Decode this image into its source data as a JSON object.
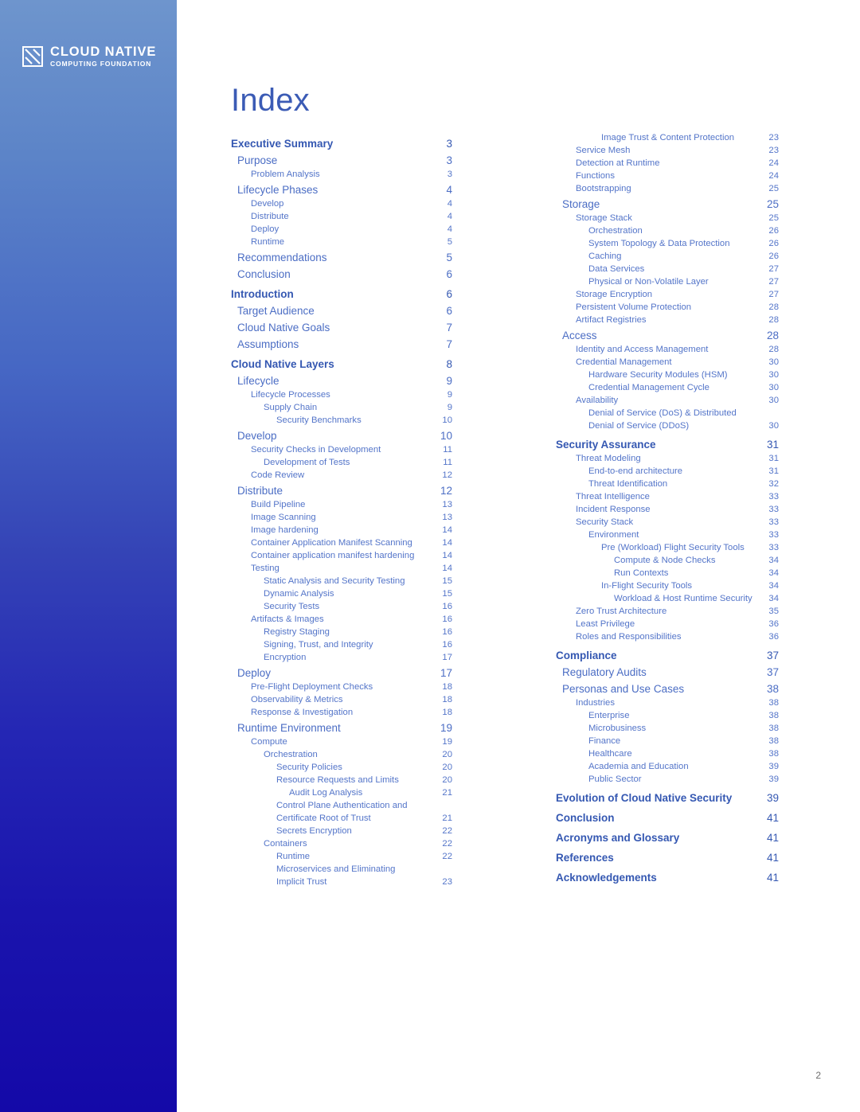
{
  "brand": {
    "logo_line1": "CLOUD NATIVE",
    "logo_line2": "COMPUTING FOUNDATION",
    "logo_icon": "cncf-mark-icon",
    "sidebar_gradient_top": "#6e95cd",
    "sidebar_gradient_mid": "#3443b6",
    "sidebar_gradient_bottom": "#1409a8"
  },
  "page": {
    "title": "Index",
    "page_number": "2",
    "title_color": "#3b5bb5",
    "level0_color": "#3558b2",
    "level1_color": "#4b6dc4",
    "sub_color": "#5475c9"
  },
  "toc": {
    "left_column": [
      {
        "label": "Executive Summary",
        "page": "3",
        "level": 0
      },
      {
        "label": "Purpose",
        "page": "3",
        "level": 1
      },
      {
        "label": "Problem Analysis",
        "page": "3",
        "level": 2
      },
      {
        "label": "Lifecycle Phases",
        "page": "4",
        "level": 1
      },
      {
        "label": "Develop",
        "page": "4",
        "level": 2
      },
      {
        "label": "Distribute",
        "page": "4",
        "level": 2
      },
      {
        "label": "Deploy",
        "page": "4",
        "level": 2
      },
      {
        "label": "Runtime",
        "page": "5",
        "level": 2
      },
      {
        "label": "Recommendations",
        "page": "5",
        "level": 1
      },
      {
        "label": "Conclusion",
        "page": "6",
        "level": 1
      },
      {
        "label": "Introduction",
        "page": "6",
        "level": 0
      },
      {
        "label": "Target Audience",
        "page": "6",
        "level": 1
      },
      {
        "label": "Cloud Native Goals",
        "page": "7",
        "level": 1
      },
      {
        "label": "Assumptions",
        "page": "7",
        "level": 1
      },
      {
        "label": "Cloud Native Layers",
        "page": "8",
        "level": 0
      },
      {
        "label": "Lifecycle",
        "page": "9",
        "level": 1
      },
      {
        "label": "Lifecycle Processes",
        "page": "9",
        "level": 2
      },
      {
        "label": "Supply Chain",
        "page": "9",
        "level": 3
      },
      {
        "label": "Security Benchmarks",
        "page": "10",
        "level": 4
      },
      {
        "label": "Develop",
        "page": "10",
        "level": 1
      },
      {
        "label": "Security Checks in Development",
        "page": "11",
        "level": 2
      },
      {
        "label": "Development of Tests",
        "page": "11",
        "level": 3
      },
      {
        "label": "Code Review",
        "page": "12",
        "level": 2
      },
      {
        "label": "Distribute",
        "page": "12",
        "level": 1
      },
      {
        "label": "Build Pipeline",
        "page": "13",
        "level": 2
      },
      {
        "label": "Image Scanning",
        "page": "13",
        "level": 2
      },
      {
        "label": "Image hardening",
        "page": "14",
        "level": 2
      },
      {
        "label": "Container Application Manifest Scanning",
        "page": "14",
        "level": 2
      },
      {
        "label": "Container application manifest hardening",
        "page": "14",
        "level": 2
      },
      {
        "label": "Testing",
        "page": "14",
        "level": 2
      },
      {
        "label": "Static Analysis and Security Testing",
        "page": "15",
        "level": 3
      },
      {
        "label": "Dynamic Analysis",
        "page": "15",
        "level": 3
      },
      {
        "label": "Security Tests",
        "page": "16",
        "level": 3
      },
      {
        "label": "Artifacts & Images",
        "page": "16",
        "level": 2
      },
      {
        "label": "Registry Staging",
        "page": "16",
        "level": 3
      },
      {
        "label": "Signing, Trust, and Integrity",
        "page": "16",
        "level": 3
      },
      {
        "label": "Encryption",
        "page": "17",
        "level": 3
      },
      {
        "label": "Deploy",
        "page": "17",
        "level": 1
      },
      {
        "label": "Pre-Flight Deployment Checks",
        "page": "18",
        "level": 2
      },
      {
        "label": "Observability & Metrics",
        "page": "18",
        "level": 2
      },
      {
        "label": "Response & Investigation",
        "page": "18",
        "level": 2
      },
      {
        "label": "Runtime Environment",
        "page": "19",
        "level": 1
      },
      {
        "label": "Compute",
        "page": "19",
        "level": 2
      },
      {
        "label": "Orchestration",
        "page": "20",
        "level": 3
      },
      {
        "label": "Security Policies",
        "page": "20",
        "level": 4
      },
      {
        "label": "Resource Requests and Limits",
        "page": "20",
        "level": 4
      },
      {
        "label": "Audit Log Analysis",
        "page": "21",
        "level": 5
      },
      {
        "label": "Control Plane Authentication and",
        "page": "",
        "level": 4,
        "continuation": true
      },
      {
        "label": "Certificate Root of Trust",
        "page": "21",
        "level": 4
      },
      {
        "label": "Secrets Encryption",
        "page": "22",
        "level": 4
      },
      {
        "label": "Containers",
        "page": "22",
        "level": 3
      },
      {
        "label": "Runtime",
        "page": "22",
        "level": 4
      },
      {
        "label": "Microservices and Eliminating",
        "page": "",
        "level": 4,
        "continuation": true
      },
      {
        "label": "Implicit Trust",
        "page": "23",
        "level": 4
      }
    ],
    "right_column": [
      {
        "label": "Image Trust & Content Protection",
        "page": "23",
        "level": 4
      },
      {
        "label": "Service Mesh",
        "page": "23",
        "level": 2
      },
      {
        "label": "Detection at Runtime",
        "page": "24",
        "level": 2
      },
      {
        "label": "Functions",
        "page": "24",
        "level": 2
      },
      {
        "label": "Bootstrapping",
        "page": "25",
        "level": 2
      },
      {
        "label": "Storage",
        "page": "25",
        "level": 1
      },
      {
        "label": "Storage Stack",
        "page": "25",
        "level": 2
      },
      {
        "label": "Orchestration",
        "page": "26",
        "level": 3
      },
      {
        "label": "System Topology & Data Protection",
        "page": "26",
        "level": 3
      },
      {
        "label": "Caching",
        "page": "26",
        "level": 3
      },
      {
        "label": "Data Services",
        "page": "27",
        "level": 3
      },
      {
        "label": "Physical  or Non-Volatile Layer",
        "page": "27",
        "level": 3
      },
      {
        "label": "Storage Encryption",
        "page": "27",
        "level": 2
      },
      {
        "label": "Persistent Volume Protection",
        "page": "28",
        "level": 2
      },
      {
        "label": "Artifact Registries",
        "page": "28",
        "level": 2
      },
      {
        "label": "Access",
        "page": "28",
        "level": 1
      },
      {
        "label": "Identity and Access Management",
        "page": "28",
        "level": 2
      },
      {
        "label": "Credential Management",
        "page": "30",
        "level": 2
      },
      {
        "label": "Hardware Security Modules (HSM)",
        "page": "30",
        "level": 3
      },
      {
        "label": "Credential Management Cycle",
        "page": "30",
        "level": 3
      },
      {
        "label": "Availability",
        "page": "30",
        "level": 2
      },
      {
        "label": "Denial of Service (DoS) & Distributed",
        "page": "",
        "level": 3,
        "continuation": true
      },
      {
        "label": "Denial of Service (DDoS)",
        "page": "30",
        "level": 3
      },
      {
        "label": "Security Assurance",
        "page": "31",
        "level": 0
      },
      {
        "label": "Threat Modeling",
        "page": "31",
        "level": 2
      },
      {
        "label": "End-to-end architecture",
        "page": "31",
        "level": 3
      },
      {
        "label": "Threat Identification",
        "page": "32",
        "level": 3
      },
      {
        "label": "Threat Intelligence",
        "page": "33",
        "level": 2
      },
      {
        "label": "Incident Response",
        "page": "33",
        "level": 2
      },
      {
        "label": "Security Stack",
        "page": "33",
        "level": 2
      },
      {
        "label": "Environment",
        "page": "33",
        "level": 3
      },
      {
        "label": "Pre (Workload) Flight Security Tools",
        "page": "33",
        "level": 4
      },
      {
        "label": "Compute & Node Checks",
        "page": "34",
        "level": 5
      },
      {
        "label": "Run Contexts",
        "page": "34",
        "level": 5
      },
      {
        "label": "In-Flight Security Tools",
        "page": "34",
        "level": 4
      },
      {
        "label": "Workload & Host Runtime Security",
        "page": "34",
        "level": 5
      },
      {
        "label": "Zero Trust Architecture",
        "page": "35",
        "level": 2
      },
      {
        "label": "Least Privilege",
        "page": "36",
        "level": 2
      },
      {
        "label": "Roles and Responsibilities",
        "page": "36",
        "level": 2
      },
      {
        "label": "Compliance",
        "page": "37",
        "level": 0
      },
      {
        "label": "Regulatory Audits",
        "page": "37",
        "level": 1
      },
      {
        "label": "Personas and Use Cases",
        "page": "38",
        "level": 1
      },
      {
        "label": "Industries",
        "page": "38",
        "level": 2
      },
      {
        "label": "Enterprise",
        "page": "38",
        "level": 3
      },
      {
        "label": "Microbusiness",
        "page": "38",
        "level": 3
      },
      {
        "label": "Finance",
        "page": "38",
        "level": 3
      },
      {
        "label": "Healthcare",
        "page": "38",
        "level": 3
      },
      {
        "label": "Academia and Education",
        "page": "39",
        "level": 3
      },
      {
        "label": "Public Sector",
        "page": "39",
        "level": 3
      },
      {
        "label": "Evolution of Cloud Native Security",
        "page": "39",
        "level": 0
      },
      {
        "label": "Conclusion",
        "page": "41",
        "level": 0
      },
      {
        "label": "Acronyms and Glossary",
        "page": "41",
        "level": 0
      },
      {
        "label": "References",
        "page": "41",
        "level": 0
      },
      {
        "label": "Acknowledgements",
        "page": "41",
        "level": 0
      }
    ]
  }
}
